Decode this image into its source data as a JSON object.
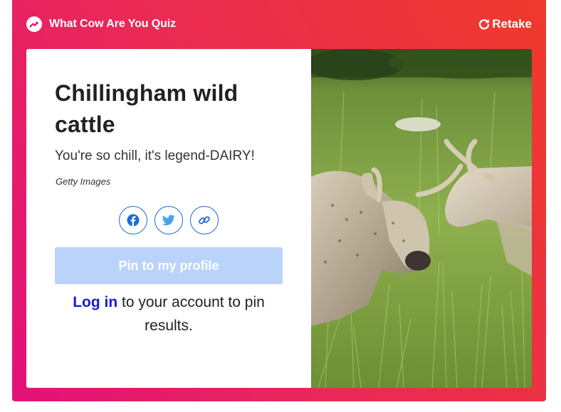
{
  "header": {
    "quiz_title": "What Cow Are You Quiz",
    "retake_label": "Retake",
    "badge_icon": "trending-arrow-icon",
    "retake_icon": "refresh-icon"
  },
  "result": {
    "title": "Chillingham wild cattle",
    "description": "You're so chill, it's legend-DAIRY!",
    "photo_credit": "Getty Images",
    "share": [
      {
        "name": "facebook-icon",
        "color": "#1c6bd6"
      },
      {
        "name": "twitter-icon",
        "color": "#1c6bd6"
      },
      {
        "name": "link-icon",
        "color": "#1c6bd6"
      }
    ],
    "pin_button_label": "Pin to my profile",
    "login_link": "Log in",
    "login_text": " to your account to pin results."
  },
  "colors": {
    "gradient_start": "#e3117a",
    "gradient_end": "#ef3a2c",
    "pin_button_bg": "#b9d3fb",
    "link_blue": "#1a1ad6",
    "icon_blue": "#1c6bd6"
  }
}
